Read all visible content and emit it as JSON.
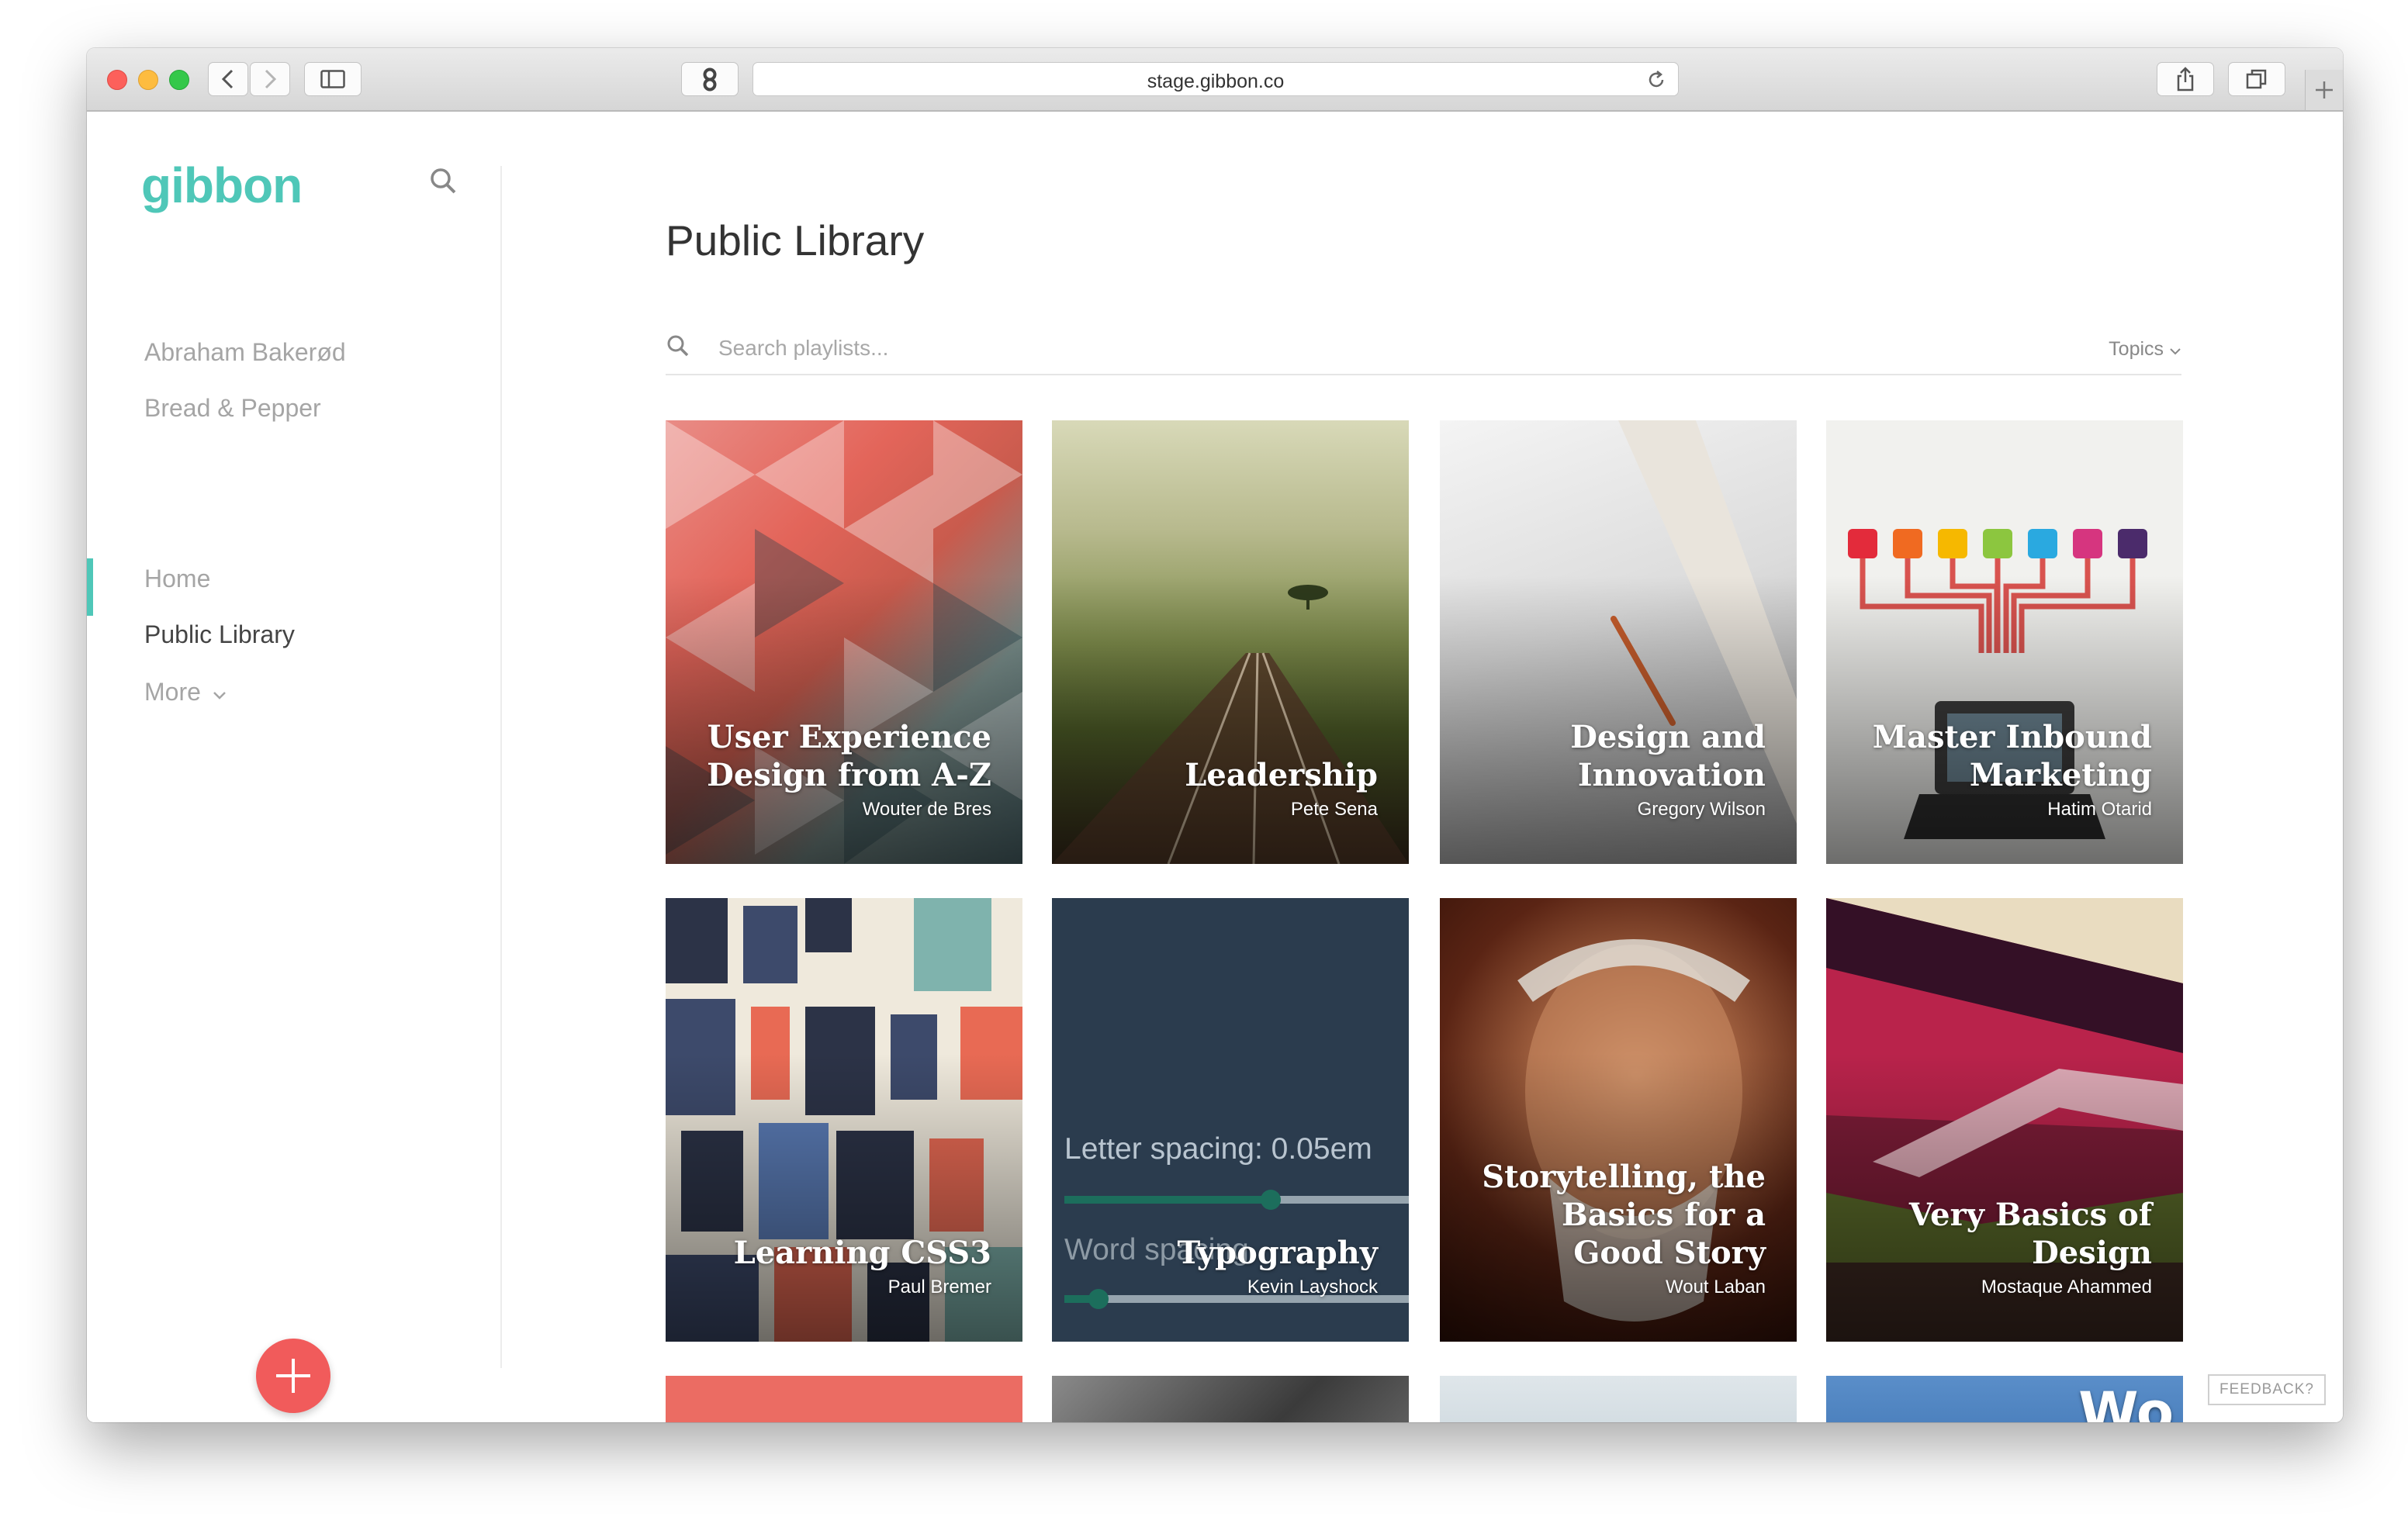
{
  "browser": {
    "url": "stage.gibbon.co",
    "colors": {
      "close": "#fc605b",
      "minimize": "#fdbc40",
      "zoom": "#34c84a"
    }
  },
  "sidebar": {
    "logo": "gibbon",
    "orgs": [
      "Abraham Bakerød",
      "Bread & Pepper"
    ],
    "nav": {
      "home": "Home",
      "public_library": "Public Library",
      "more": "More"
    }
  },
  "main": {
    "title": "Public Library",
    "search_placeholder": "Search playlists...",
    "topics_label": "Topics"
  },
  "cards": [
    {
      "title": "User Experience Design from A-Z",
      "author": "Wouter de Bres"
    },
    {
      "title": "Leadership",
      "author": "Pete Sena"
    },
    {
      "title": "Design and Innovation",
      "author": "Gregory Wilson"
    },
    {
      "title": "Master Inbound Marketing",
      "author": "Hatim Otarid"
    },
    {
      "title": "Learning CSS3",
      "author": "Paul Bremer"
    },
    {
      "title": "Typography",
      "author": "Kevin Layshock"
    },
    {
      "title": "Storytelling, the Basics for a Good Story",
      "author": "Wout Laban"
    },
    {
      "title": "Very Basics of Design",
      "author": "Mostaque Ahammed"
    }
  ],
  "typography_card": {
    "letter_spacing_label": "Letter spacing: 0.05em",
    "word_spacing_label": "Word spacing",
    "letter_spacing_value": 0.6,
    "word_spacing_value": 0.1
  },
  "row3_cards": [
    {
      "visible_text": ""
    },
    {
      "visible_text": ""
    },
    {
      "visible_text": ""
    },
    {
      "visible_text": "Wo"
    }
  ],
  "feedback": "FEEDBACK?"
}
